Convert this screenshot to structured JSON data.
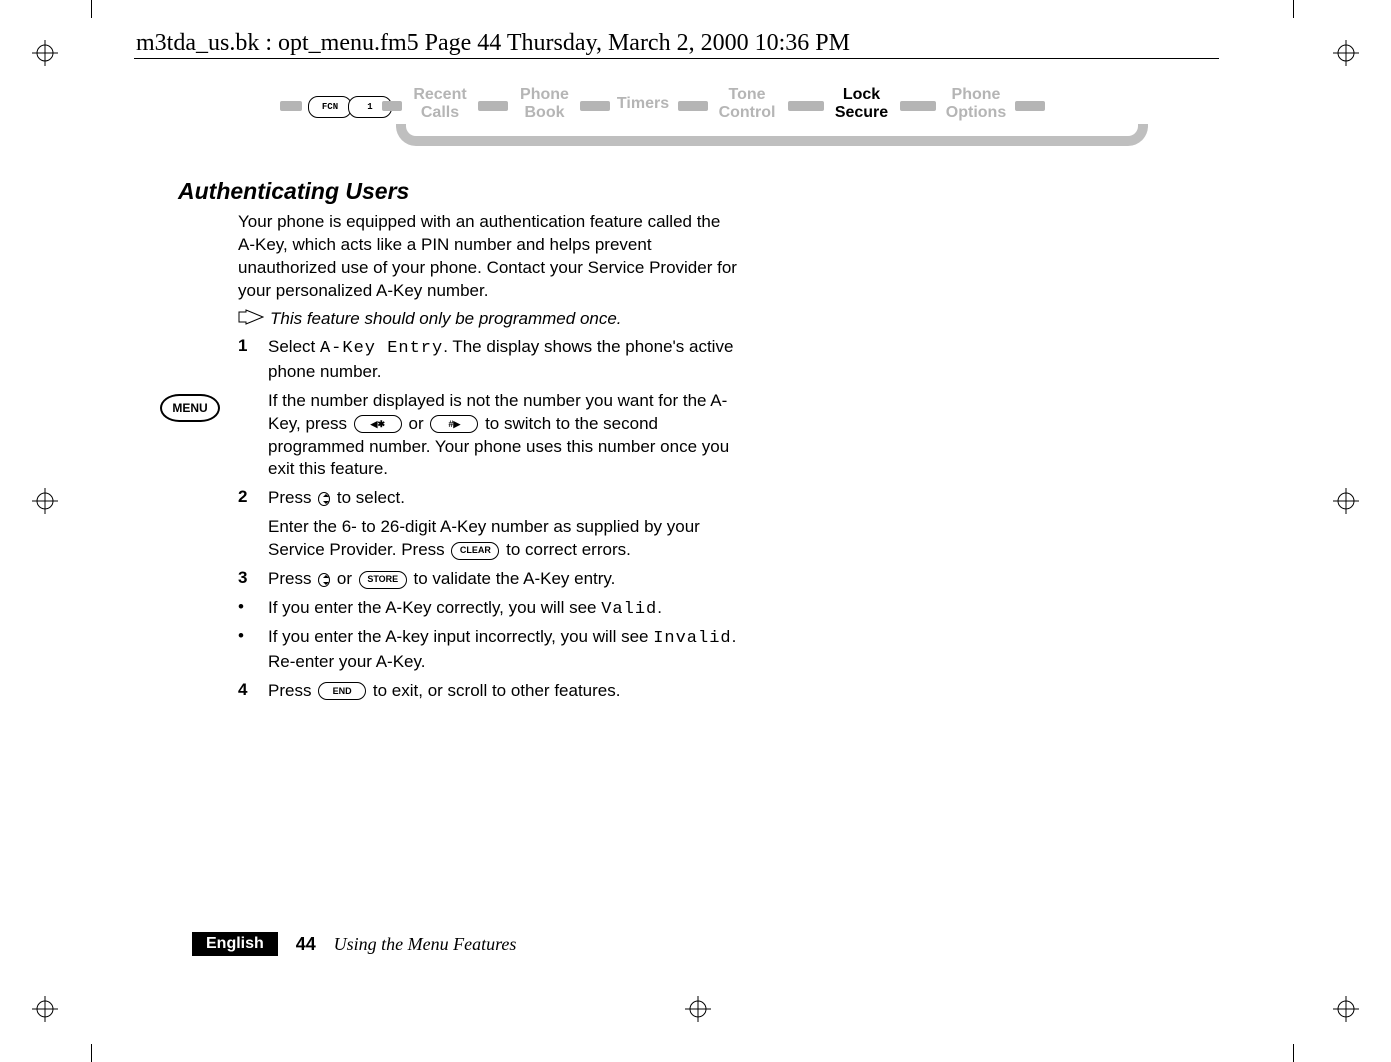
{
  "running_header": "m3tda_us.bk : opt_menu.fm5  Page 44  Thursday, March 2, 2000  10:36 PM",
  "nav": {
    "fcn_label": "FCN",
    "one_label": "1",
    "items": [
      {
        "label": "Recent\nCalls",
        "active": false
      },
      {
        "label": "Phone\nBook",
        "active": false
      },
      {
        "label": "Timers",
        "active": false
      },
      {
        "label": "Tone\nControl",
        "active": false
      },
      {
        "label": "Lock\nSecure",
        "active": true
      },
      {
        "label": "Phone\nOptions",
        "active": false
      }
    ]
  },
  "section_title": "Authenticating Users",
  "intro": "Your phone is equipped with an authentication feature called the A-Key, which acts like a PIN number and helps prevent unauthorized use of your phone. Contact your Service Provider for your personalized A-Key number.",
  "note": "This feature should only be programmed once.",
  "keys": {
    "star": "✱",
    "hash": "#",
    "clear": "CLEAR",
    "store": "STORE",
    "end": "END"
  },
  "steps": {
    "s1_a": "Select ",
    "s1_lcd": "A-Key Entry",
    "s1_b": ". The display shows the phone's active phone number.",
    "s1_sub_a": "If the number displayed is not the number you want for the A-Key, press ",
    "s1_sub_b": " or ",
    "s1_sub_c": " to switch to the second programmed number. Your phone uses this number once you exit this feature.",
    "s2_a": "Press ",
    "s2_b": " to select.",
    "s2_sub_a": "Enter the 6- to 26-digit A-Key number as supplied by your Service Provider. Press ",
    "s2_sub_b": " to correct errors.",
    "s3_a": "Press ",
    "s3_b": " or ",
    "s3_c": " to validate the A-Key entry.",
    "b1_a": "If you enter the A-Key correctly, you will see ",
    "b1_lcd": "Valid",
    "b1_b": ".",
    "b2_a": "If you enter the A-key input incorrectly, you will see ",
    "b2_lcd": "Invalid",
    "b2_b": ". Re-enter your A-Key.",
    "s4_a": "Press ",
    "s4_b": " to exit, or scroll to other features."
  },
  "margin_label": "MENU",
  "footer": {
    "language": "English",
    "page_number": "44",
    "page_title": "Using the Menu Features"
  }
}
